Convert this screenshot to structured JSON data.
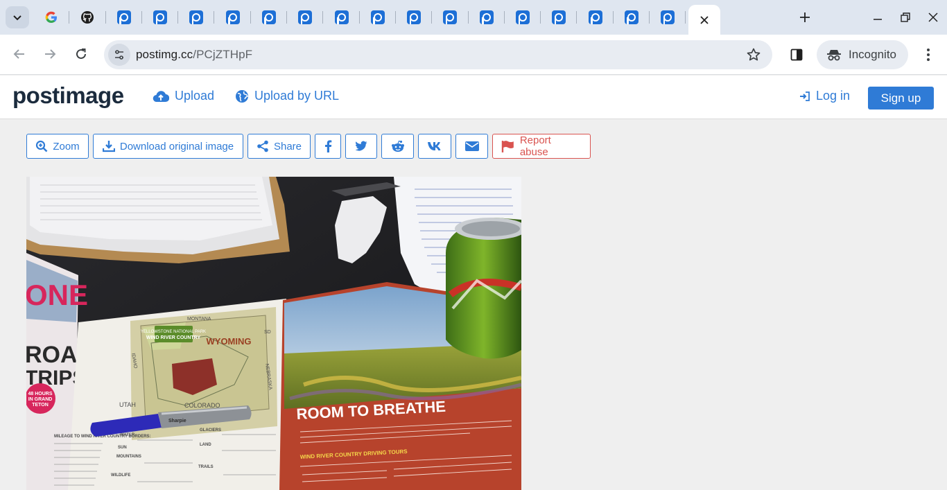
{
  "browser": {
    "tabs_icons": [
      "google-favicon",
      "github-favicon",
      "postimage-favicon"
    ],
    "url_host": "postimg.cc",
    "url_path": "/PCjZTHpF",
    "incognito_label": "Incognito"
  },
  "site": {
    "logo_text_a": "post",
    "logo_text_b": "image",
    "upload_label": "Upload",
    "upload_url_label": "Upload by URL",
    "login_label": "Log in",
    "signup_label": "Sign up"
  },
  "actions": {
    "zoom": "Zoom",
    "download": "Download original image",
    "share": "Share",
    "report": "Report abuse"
  },
  "photo": {
    "brochure_title": "ROOM TO BREATHE",
    "map_state": "WYOMING",
    "map_region": "WIND RIVER COUNTRY",
    "map_park": "YELLOWSTONE NATIONAL PARK",
    "map_montana": "MONTANA",
    "map_utah": "UTAH",
    "map_colorado": "COLORADO",
    "map_nebraska": "NEBRASKA",
    "map_idaho": "IDAHO",
    "map_sd": "SD",
    "tours_heading": "WIND RIVER COUNTRY DRIVING TOURS",
    "magazine_one": "ONE",
    "magazine_road": "ROAD",
    "magazine_trips": "TRIPS",
    "badge_line1": "48 HOURS",
    "badge_line2": "IN GRAND",
    "badge_line3": "TETON",
    "mileage_heading": "MILEAGE TO WIND RIVER COUNTRY BORDERS:",
    "water_label": "WATER",
    "sun_label": "SUN",
    "mountains_label": "MOUNTAINS",
    "wildlife_label": "WILDLIFE",
    "glaciers_label": "GLACIERS",
    "land_label": "LAND",
    "trails_label": "TRAILS"
  },
  "colors": {
    "accent": "#2f7bd6",
    "danger": "#d9534f"
  }
}
